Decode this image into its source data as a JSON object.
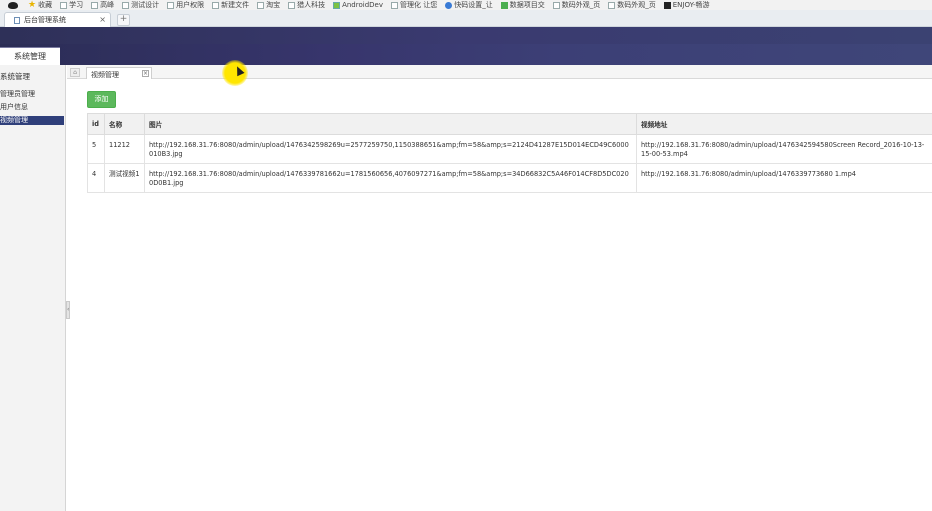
{
  "bookmarks": [
    {
      "label": "收藏",
      "icon": "star-icon"
    },
    {
      "label": "学习",
      "icon": "folder-icon"
    },
    {
      "label": "高峰",
      "icon": "folder-icon"
    },
    {
      "label": "测试设计",
      "icon": "folder-icon"
    },
    {
      "label": "用户权限",
      "icon": "folder-icon"
    },
    {
      "label": "新建文件",
      "icon": "folder-icon"
    },
    {
      "label": "淘宝",
      "icon": "folder-icon"
    },
    {
      "label": "猎人科技",
      "icon": "folder-icon"
    },
    {
      "label": "AndroidDev",
      "icon": "android-icon"
    },
    {
      "label": "管理化 让您",
      "icon": "page-icon"
    },
    {
      "label": "快码设置_让",
      "icon": "globe-icon"
    },
    {
      "label": "数据项目交",
      "icon": "grid-icon"
    },
    {
      "label": "数码外观_页",
      "icon": "page-icon"
    },
    {
      "label": "数码外观_页",
      "icon": "page-icon"
    },
    {
      "label": "ENJOY-畅游",
      "icon": "e-icon"
    }
  ],
  "browser_tab": {
    "title": "后台管理系统",
    "close": "×"
  },
  "new_tab": "+",
  "app": {
    "menu_title": "系统管理"
  },
  "sidebar": {
    "group": "系统管理",
    "items": [
      {
        "label": "管理员管理",
        "active": false
      },
      {
        "label": "用户信息",
        "active": false
      },
      {
        "label": "视频管理",
        "active": true
      }
    ]
  },
  "content_tabs": {
    "home": "⌂",
    "active_tab": "视频管理",
    "close": "×"
  },
  "toolbar": {
    "add_label": "添加"
  },
  "table": {
    "headers": {
      "id": "id",
      "name": "名称",
      "picture": "图片",
      "video": "视频地址"
    },
    "rows": [
      {
        "id": "5",
        "name": "11212",
        "picture": "http://192.168.31.76:8080/admin/upload/1476342598269u=2577259750,1150388651&amp;fm=58&amp;s=2124D41287E15D014ECD49C6000010B3.jpg",
        "video": "http://192.168.31.76:8080/admin/upload/1476342594580Screen Record_2016-10-13-15-00-53.mp4"
      },
      {
        "id": "4",
        "name": "测试视频1",
        "picture": "http://192.168.31.76:8080/admin/upload/1476339781662u=1781560656,4076097271&amp;fm=58&amp;s=34D66832C5A46F014CF8D5DC0200D0B1.jpg",
        "video": "http://192.168.31.76:8080/admin/upload/1476339773680 1.mp4"
      }
    ]
  },
  "colors": {
    "header_start": "#2b2d55",
    "header_end": "#3f4679",
    "active_item": "#2f3f7a",
    "add_button": "#5cb85c",
    "cursor_highlight": "#ffe600"
  }
}
